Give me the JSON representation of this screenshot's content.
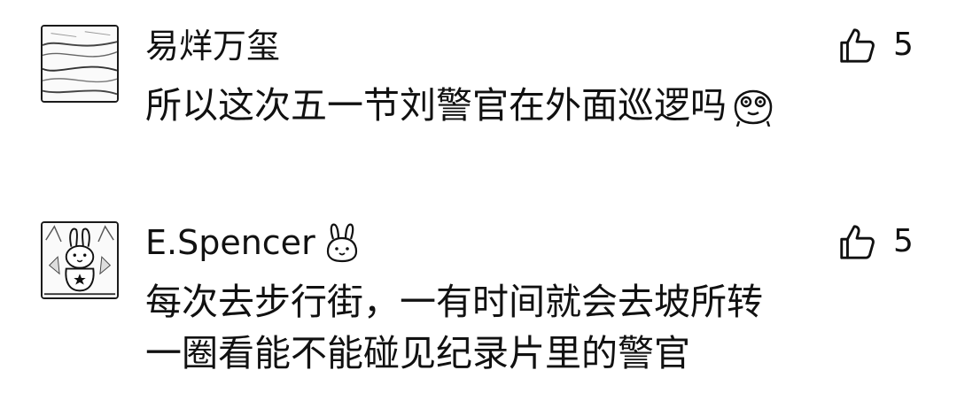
{
  "comments": [
    {
      "username": "易烊万玺",
      "text_lines": [
        "所以这次五一节刘警官在外面巡逻吗"
      ],
      "inline_emoji": "cute-face-emoji",
      "likes": "5",
      "avatar": "landscape-sketch-avatar"
    },
    {
      "username": "E.Spencer",
      "name_emoji": "bunny-emoji",
      "text_lines": [
        "每次去步行街，一有时间就会去坡所转",
        "一圈看能不能碰见纪录片里的警官"
      ],
      "likes": "5",
      "avatar": "bunny-drawing-avatar"
    }
  ],
  "like_icon": "thumbs-up-icon"
}
